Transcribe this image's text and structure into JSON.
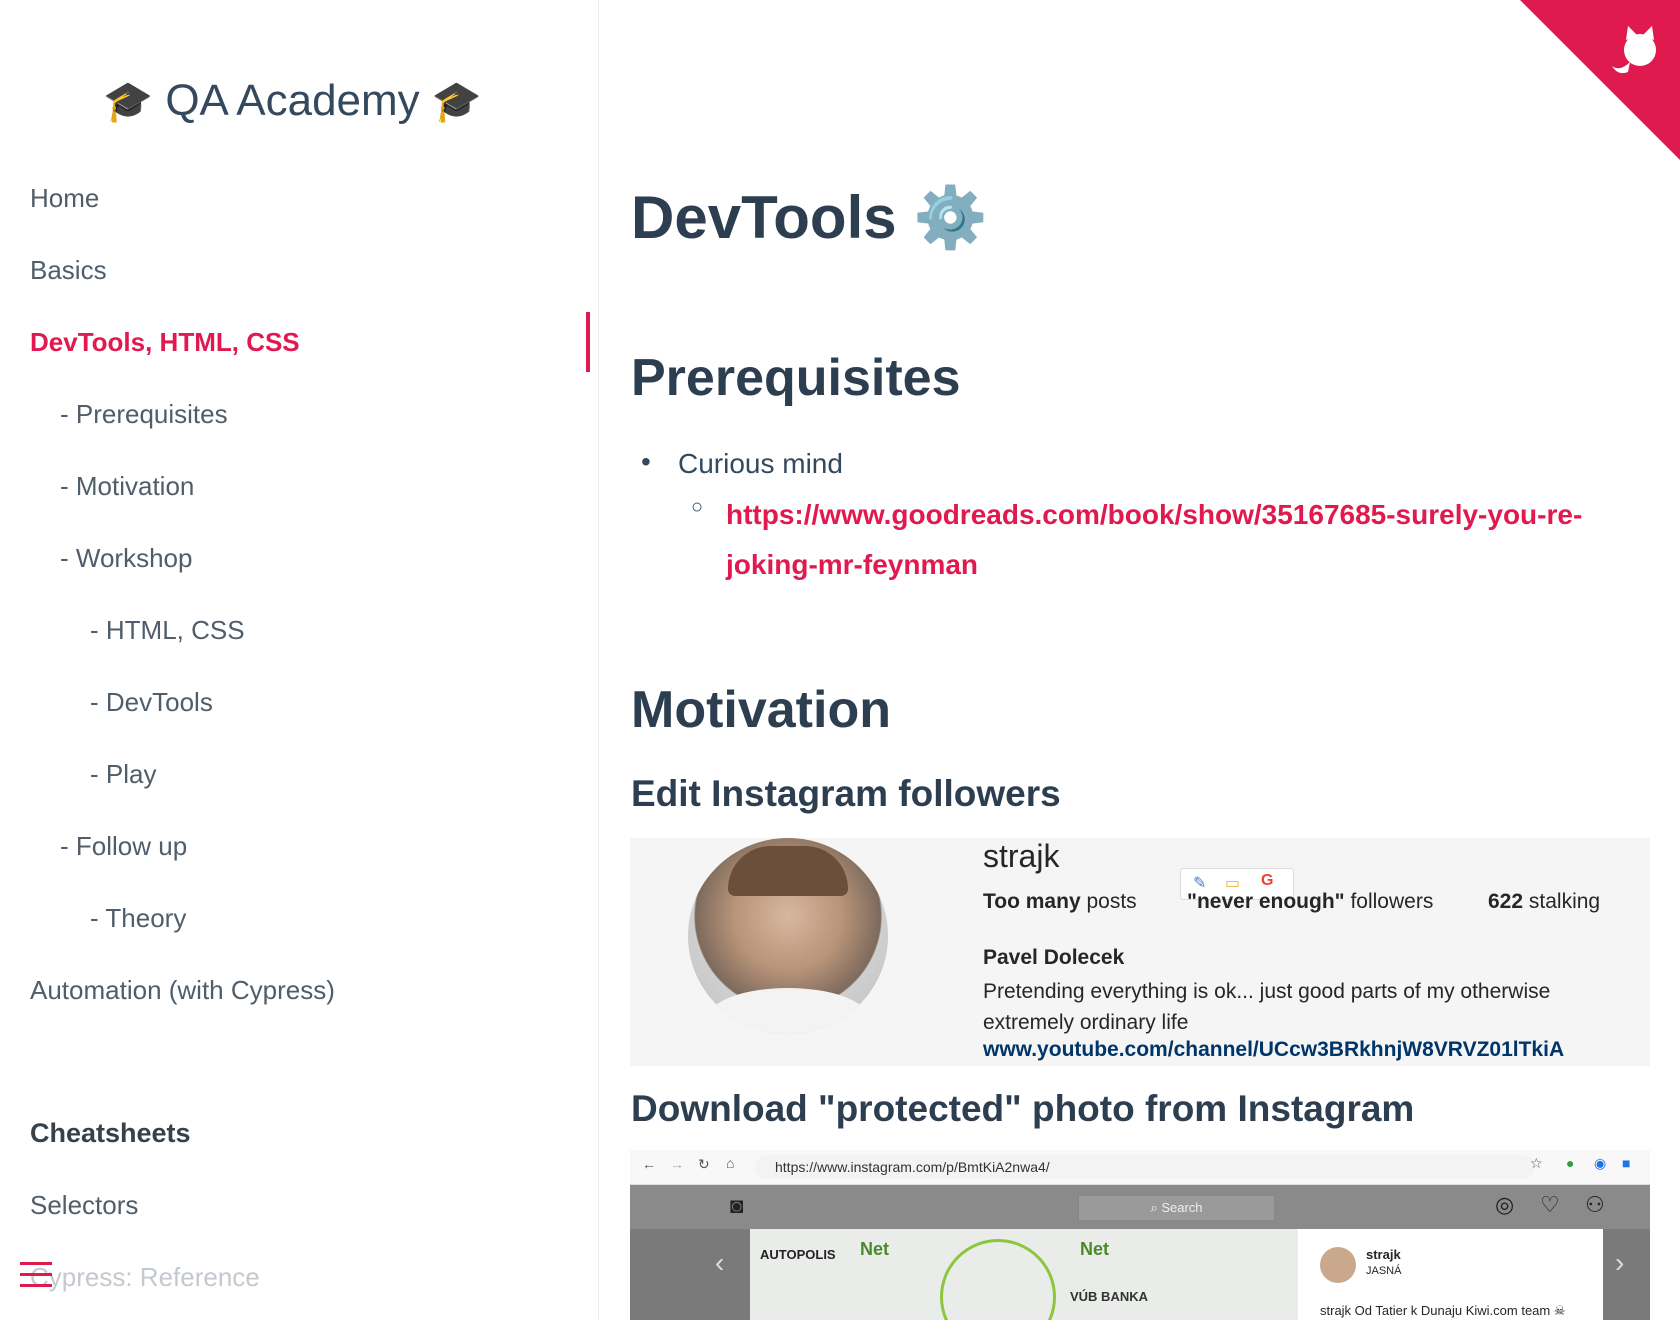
{
  "app": {
    "title": "QA Academy",
    "cap_glyph": "🎓"
  },
  "sidebar": {
    "items": [
      {
        "label": "Home"
      },
      {
        "label": "Basics"
      },
      {
        "label": "DevTools, HTML, CSS"
      },
      {
        "label": "- Prerequisites"
      },
      {
        "label": "- Motivation"
      },
      {
        "label": "- Workshop"
      },
      {
        "label": "- HTML, CSS"
      },
      {
        "label": "- DevTools"
      },
      {
        "label": "- Play"
      },
      {
        "label": "- Follow up"
      },
      {
        "label": "- Theory"
      },
      {
        "label": "Automation (with Cypress)"
      }
    ],
    "section_title": "Cheatsheets",
    "section_items": [
      {
        "label": "Selectors"
      },
      {
        "label": "Cypress: Reference"
      }
    ]
  },
  "main": {
    "title": "DevTools",
    "title_glyph": "⚙️",
    "prereq_heading": "Prerequisites",
    "prereq_bullet": "Curious mind",
    "prereq_link": "https://www.goodreads.com/book/show/35167685-surely-you-re-joking-mr-feynman",
    "motivation_heading": "Motivation",
    "sub1": "Edit Instagram followers",
    "sub2": "Download \"protected\" photo from Instagram"
  },
  "instagram_profile": {
    "username": "strajk",
    "posts_value": "Too many",
    "posts_label": "posts",
    "followers_value": "\"never enough\"",
    "followers_label": "followers",
    "following_value": "622",
    "following_label": "stalking",
    "name": "Pavel Dolecek",
    "bio": "Pretending everything is ok... just good parts of my otherwise extremely ordinary life",
    "link": "www.youtube.com/channel/UCcw3BRkhnjW8VRVZ01lTkiA"
  },
  "instagram_post": {
    "url": "https://www.instagram.com/p/BmtKiA2nwa4/",
    "search_placeholder": "Search",
    "username": "strajk",
    "location": "JASNÁ",
    "caption": "strajk Od Tatier k Dunaju Kiwi.com team ☠",
    "sponsors": [
      "AUTOPOLIS",
      "Net",
      "VÚB BANKA"
    ]
  },
  "colors": {
    "accent": "#e0194e",
    "heading": "#2c3e50",
    "text": "#34495e"
  }
}
